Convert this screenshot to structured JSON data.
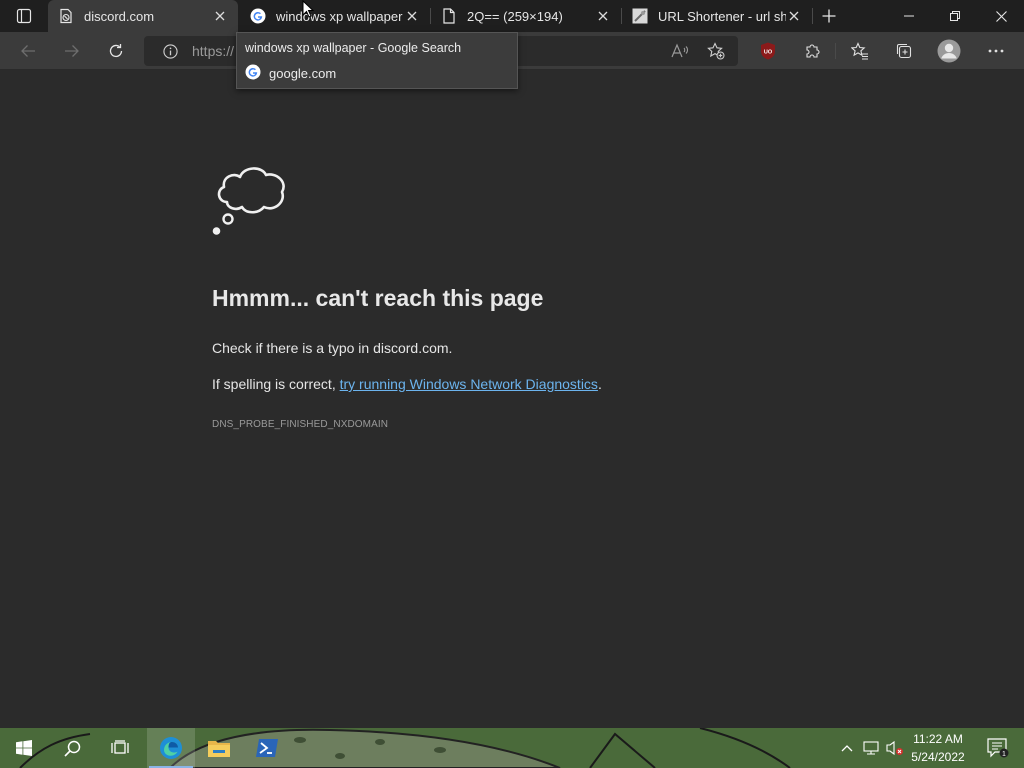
{
  "tabs": [
    {
      "title": "discord.com",
      "icon": "discord-tab-icon",
      "active": true
    },
    {
      "title": "windows xp wallpaper - Google Search",
      "icon": "google-icon",
      "active": false
    },
    {
      "title": "2Q== (259×194)",
      "icon": "page-icon",
      "active": false
    },
    {
      "title": "URL Shortener - url shortener",
      "icon": "url-shortener-icon",
      "active": false
    }
  ],
  "address_bar": {
    "url": "https://"
  },
  "tooltip": {
    "title": "windows xp wallpaper - Google Search",
    "domain": "google.com"
  },
  "error": {
    "title": "Hmmm... can't reach this page",
    "line1": "Check if there is a typo in discord.com.",
    "line2_prefix": "If spelling is correct, ",
    "line2_link": "try running Windows Network Diagnostics",
    "line2_suffix": ".",
    "code": "DNS_PROBE_FINISHED_NXDOMAIN"
  },
  "taskbar": {
    "pinned": [
      "start-icon",
      "search-icon",
      "task-view-icon",
      "edge-icon",
      "file-explorer-icon",
      "powershell-icon"
    ],
    "clock_time": "11:22 AM",
    "clock_date": "5/24/2022",
    "notification_count": "1"
  },
  "colors": {
    "accent_link": "#6cb4ee",
    "page_bg": "#2b2b2b",
    "ublock_red": "#8b1a1a"
  }
}
